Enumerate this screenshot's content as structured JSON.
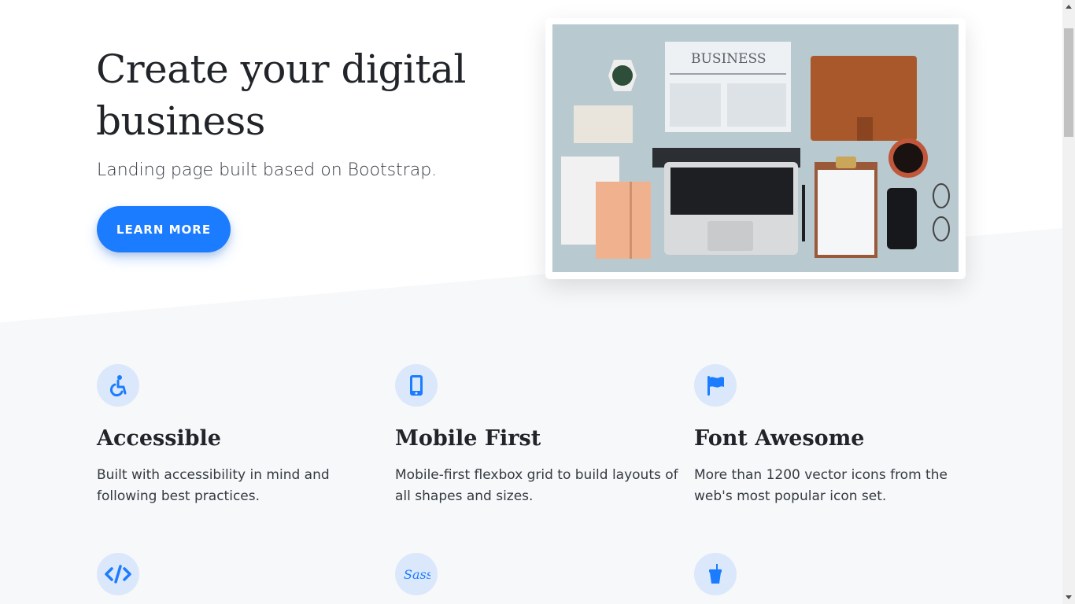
{
  "hero": {
    "title": "Create your digital business",
    "subtitle": "Landing page built based on Bootstrap.",
    "cta_label": "LEARN MORE",
    "image_headline": "BUSINESS"
  },
  "features": [
    {
      "icon": "wheelchair-icon",
      "title": "Accessible",
      "text": "Built with accessibility in mind and following best practices."
    },
    {
      "icon": "mobile-phone-icon",
      "title": "Mobile First",
      "text": "Mobile-first flexbox grid to build layouts of all shapes and sizes."
    },
    {
      "icon": "flag-icon",
      "title": "Font Awesome",
      "text": "More than 1200 vector icons from the web's most popular icon set."
    },
    {
      "icon": "code-icon",
      "title": "",
      "text": ""
    },
    {
      "icon": "sass-icon",
      "title": "",
      "text": ""
    },
    {
      "icon": "cup-icon",
      "title": "",
      "text": ""
    }
  ],
  "colors": {
    "accent": "#1c7cff",
    "icon_bg": "#dbe8fb",
    "section_bg": "#f7f8fa",
    "image_bg": "#b8c9cf"
  }
}
